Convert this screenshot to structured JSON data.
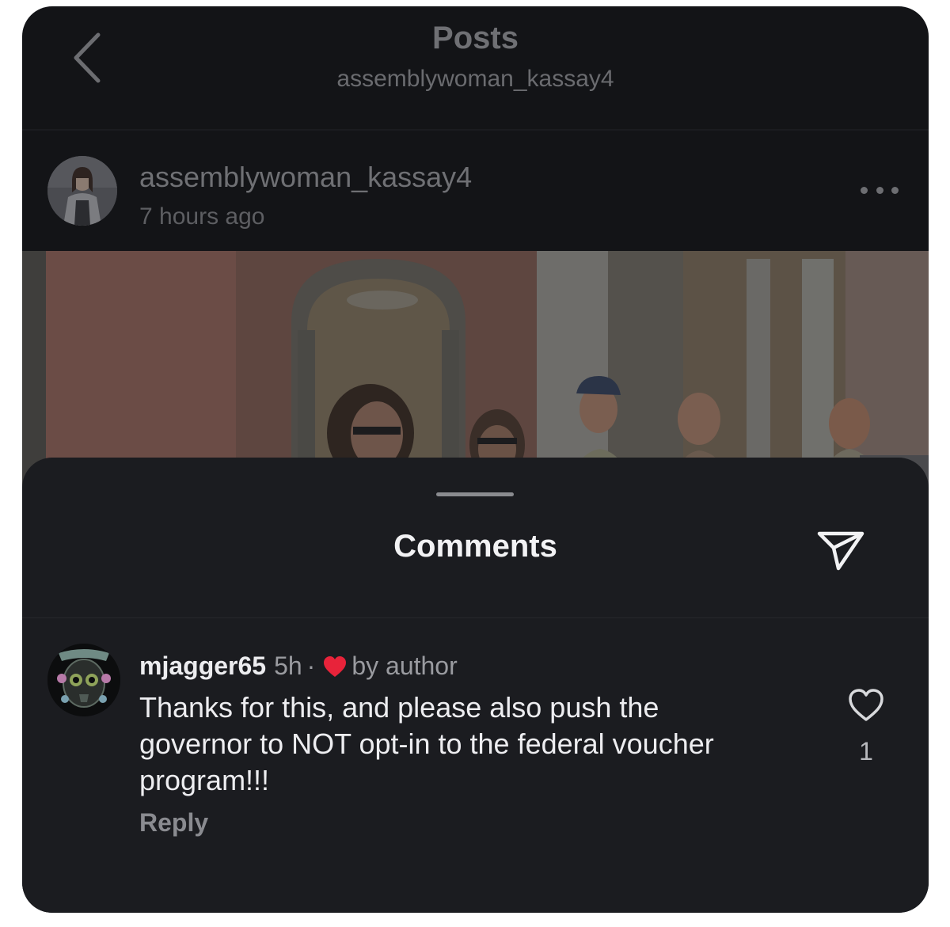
{
  "nav": {
    "title": "Posts",
    "subtitle": "assemblywoman_kassay4"
  },
  "post": {
    "username": "assemblywoman_kassay4",
    "time": "7 hours ago"
  },
  "comments_sheet": {
    "title": "Comments",
    "comment": {
      "username": "mjagger65",
      "time": "5h",
      "separator": "·",
      "liked_by_author": "by author",
      "text": "Thanks for this, and please also push the governor to NOT opt-in to the federal voucher program!!!",
      "reply_label": "Reply",
      "like_count": "1"
    }
  },
  "colors": {
    "background": "#131417",
    "sheet": "#1b1c20",
    "author_heart": "#e8233a"
  }
}
